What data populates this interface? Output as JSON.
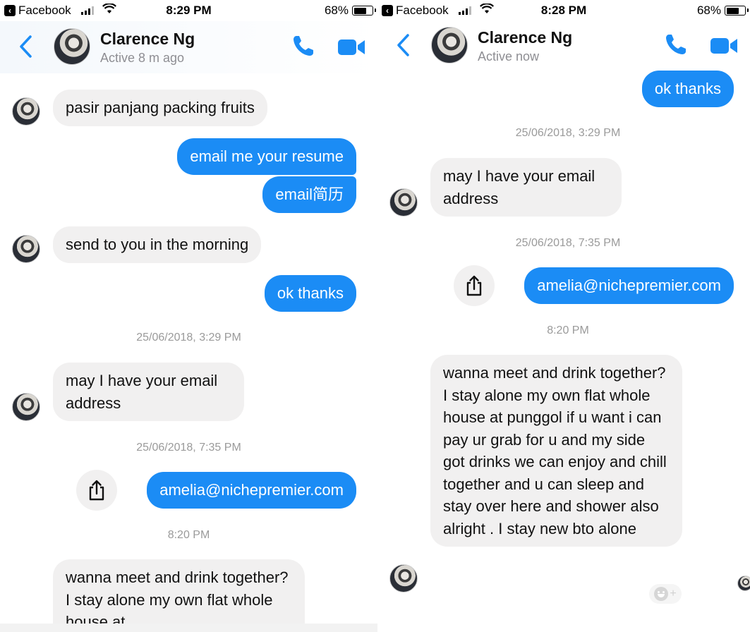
{
  "left": {
    "status_bar": {
      "back_app": "Facebook",
      "time": "8:29 PM",
      "battery": "68%"
    },
    "header": {
      "name": "Clarence Ng",
      "status": "Active 8 m ago"
    },
    "messages": [
      {
        "text": "pasir  panjang packing fruits"
      },
      {
        "text": "email me your resume"
      },
      {
        "text": "email简历"
      },
      {
        "text": "send to you in the morning"
      },
      {
        "text": "ok thanks"
      },
      {
        "text": "25/06/2018, 3:29 PM"
      },
      {
        "text": "may I have your email address"
      },
      {
        "text": "25/06/2018, 7:35 PM"
      },
      {
        "text": "amelia@nichepremier.com"
      },
      {
        "text": "8:20 PM"
      },
      {
        "text": "wanna meet and drink together?  I stay alone my own flat whole house at"
      }
    ]
  },
  "right": {
    "status_bar": {
      "back_app": "Facebook",
      "time": "8:28 PM",
      "battery": "68%"
    },
    "header": {
      "name": "Clarence Ng",
      "status": "Active now"
    },
    "messages": [
      {
        "text": "ok thanks"
      },
      {
        "text": "25/06/2018, 3:29 PM"
      },
      {
        "text": "may I have your email address"
      },
      {
        "text": "25/06/2018, 7:35 PM"
      },
      {
        "text": "amelia@nichepremier.com"
      },
      {
        "text": "8:20 PM"
      },
      {
        "text": "wanna meet and drink together?  I stay alone my own flat whole house at punggol if u want i can pay ur grab for u and my side got drinks we can enjoy and chill together and u can sleep and stay over here and shower also alright . I stay new bto alone"
      }
    ]
  },
  "icons": {
    "back": "chevron-left-icon",
    "call": "phone-icon",
    "video": "video-camera-icon",
    "share": "share-icon",
    "react": "emoji-add-icon"
  },
  "colors": {
    "accent": "#1b8cf5",
    "incoming_bubble": "#f1f0f0",
    "meta_text": "#9a9a9a"
  },
  "battery_level": 0.68
}
